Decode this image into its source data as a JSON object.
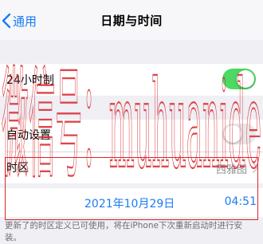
{
  "nav": {
    "back_label": "通用",
    "title": "日期与时间"
  },
  "rows": {
    "hour24": {
      "label": "24小时制",
      "on": true
    },
    "auto_set": {
      "label": "自动设置",
      "on": false
    },
    "timezone": {
      "label": "时区",
      "value": "西雅图"
    }
  },
  "date_picker": {
    "date": "2021年10月29日",
    "time": "04:51"
  },
  "footnote": "更新了的时区定义已可使用，将在iPhone下次重新启动时进行安装。",
  "watermark": "微信号：muhuanide",
  "colors": {
    "accent": "#1a7cf6",
    "toggle_on": "#4cd964",
    "toggle_off": "#e9e9eb",
    "frame": "#d9262c"
  }
}
